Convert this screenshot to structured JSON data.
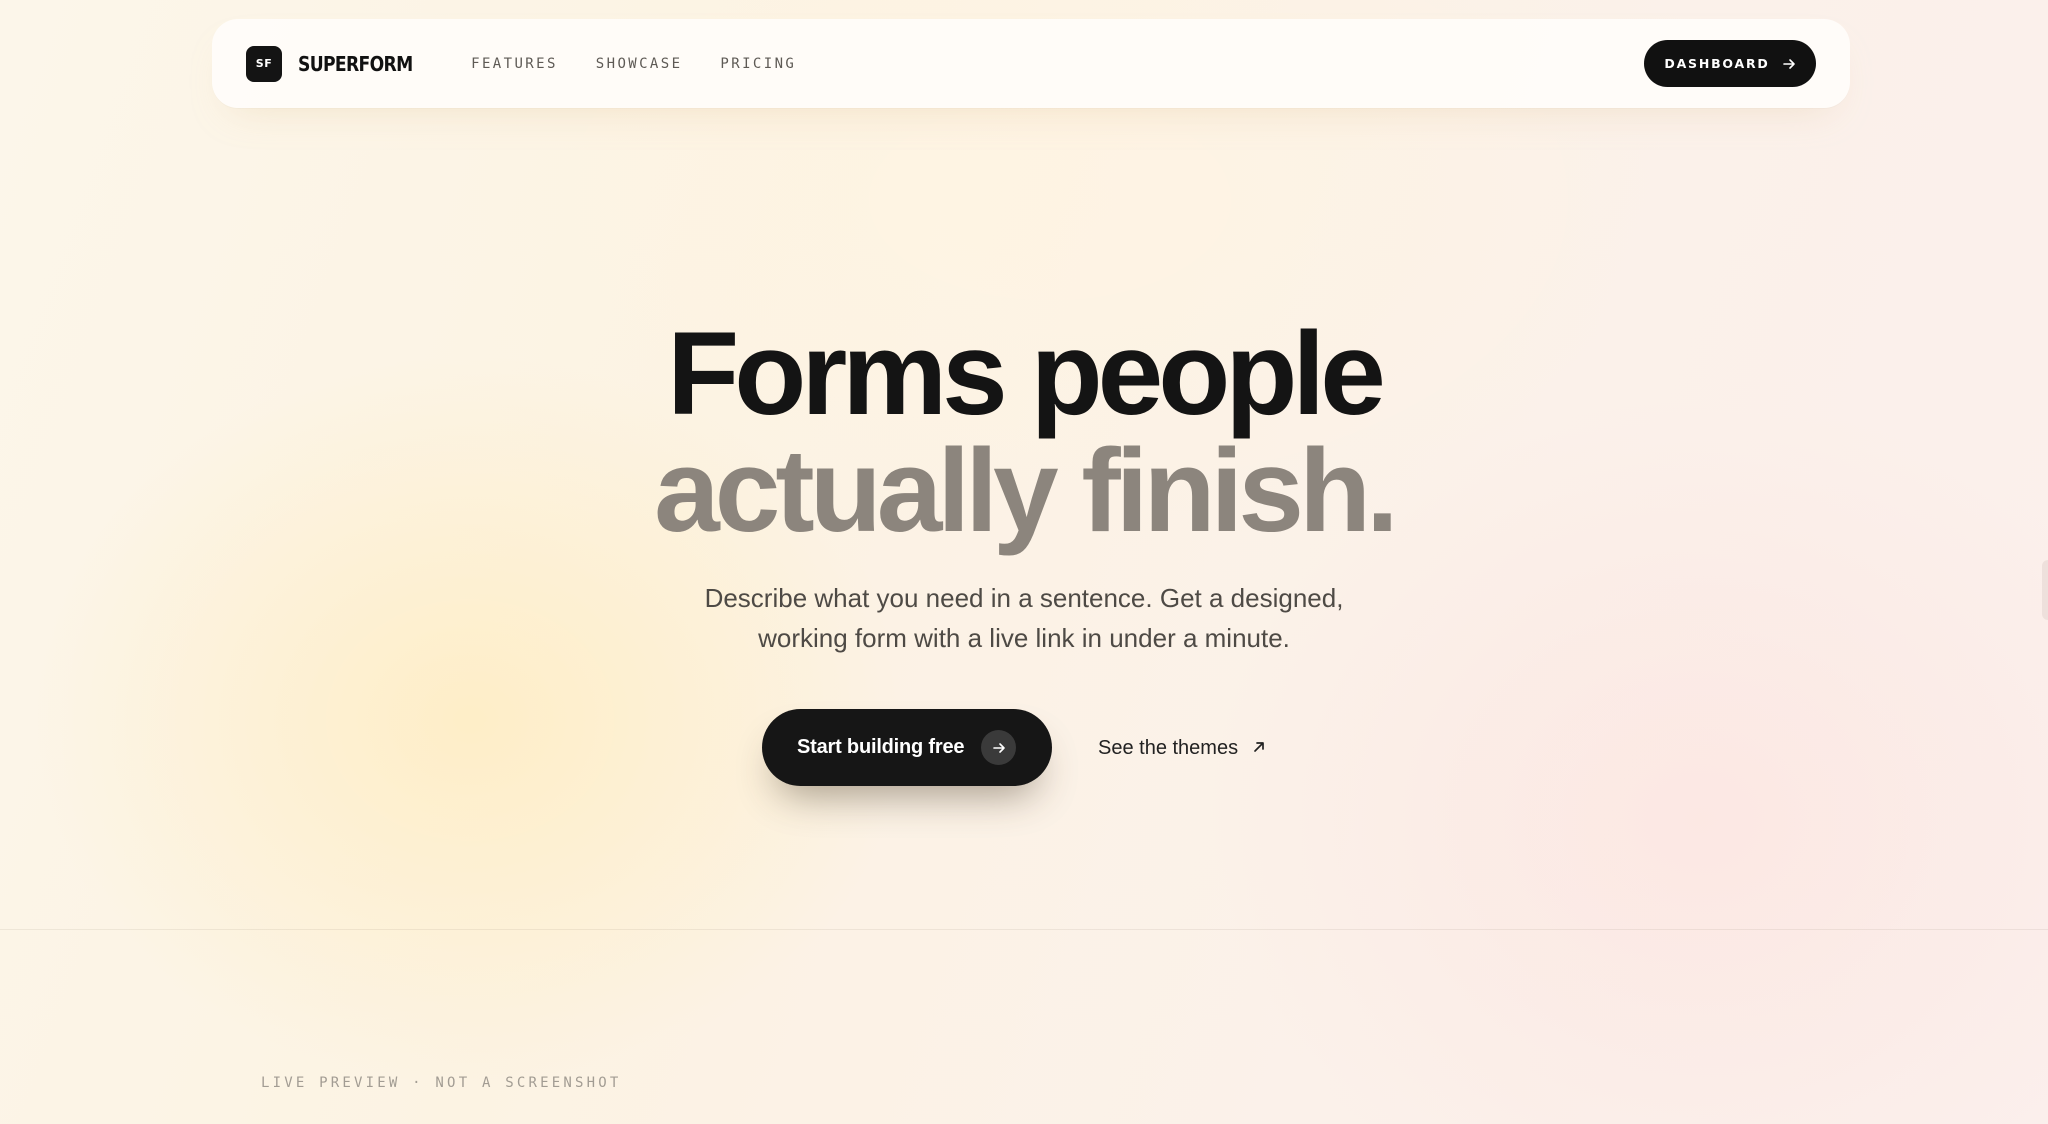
{
  "nav": {
    "logo_mark": "SF",
    "logo_text": "SUPERFORM",
    "links": [
      "FEATURES",
      "SHOWCASE",
      "PRICING"
    ],
    "dashboard_label": "DASHBOARD",
    "dashboard_icon": "arrow-right-icon"
  },
  "hero": {
    "headline_line1": "Forms people",
    "headline_line2": "actually finish.",
    "subtitle_line1": "Describe what you need in a sentence. Get a designed,",
    "subtitle_line2": "working form with a live link in under a minute.",
    "primary_cta_label": "Start building free",
    "primary_cta_icon": "arrow-right-icon",
    "secondary_cta_label": "See the themes",
    "secondary_cta_icon": "arrow-up-right-icon"
  },
  "preview": {
    "label": "LIVE PREVIEW · NOT A SCREENSHOT"
  },
  "colors": {
    "ink": "#141414",
    "muted_headline": "#8c857d",
    "body_text": "#4e4a45",
    "button_dark": "#161616",
    "background_warm": "#fcf3e3"
  }
}
